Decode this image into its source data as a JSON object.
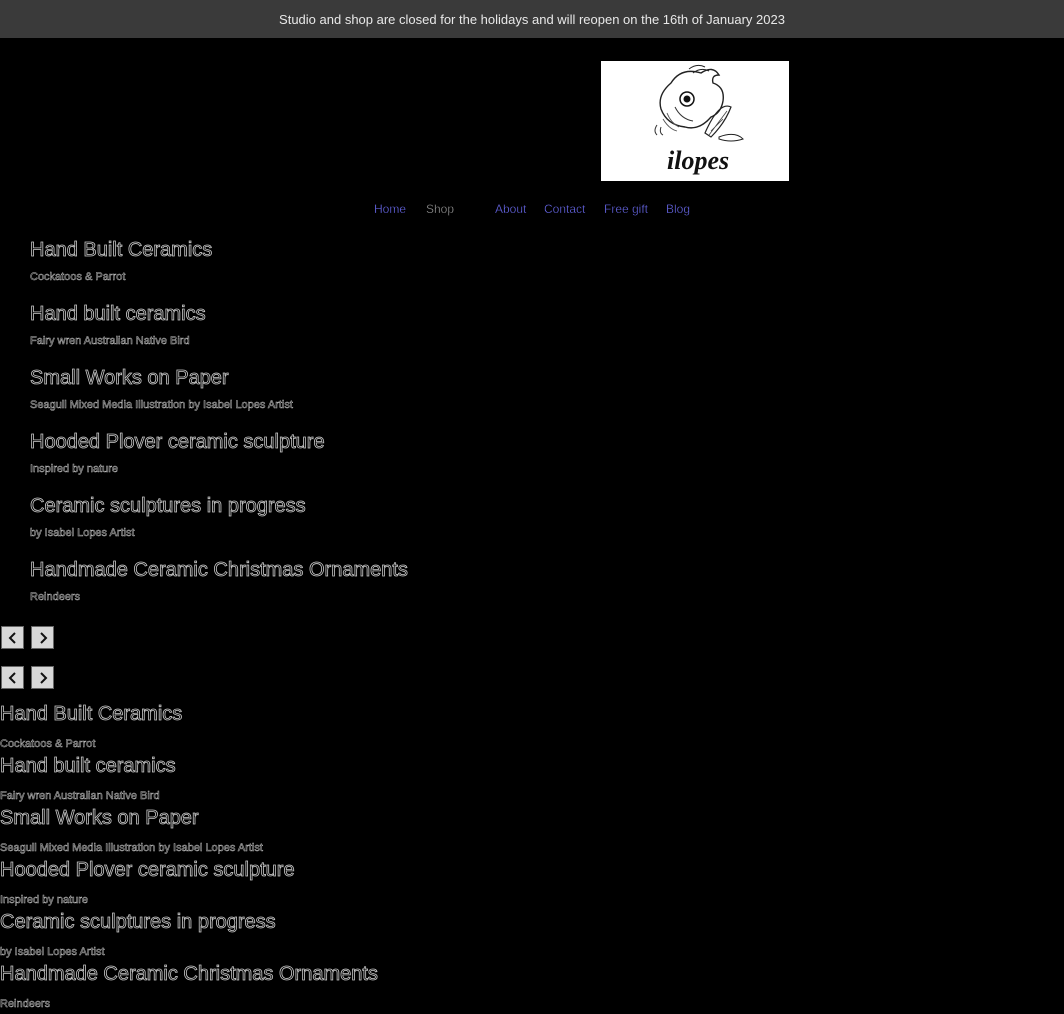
{
  "announcement": {
    "text": "Studio and shop are closed for the holidays and will reopen on the 16th of January 2023"
  },
  "logo": {
    "text": "ilopes"
  },
  "nav": {
    "items": [
      {
        "label": "Home"
      },
      {
        "label": "Shop"
      },
      {
        "label": "About"
      },
      {
        "label": "Contact"
      },
      {
        "label": "Free gift"
      },
      {
        "label": "Blog"
      }
    ]
  },
  "slides": [
    {
      "title": "Hand Built Ceramics",
      "subtitle": "Cockatoos & Parrot"
    },
    {
      "title": "Hand built ceramics",
      "subtitle": "Fairy wren Australian Native Bird"
    },
    {
      "title": "Small Works on Paper",
      "subtitle": "Seagull Mixed Media Illustration by Isabel Lopes Artist"
    },
    {
      "title": "Hooded Plover ceramic sculpture",
      "subtitle": "Inspired by nature"
    },
    {
      "title": "Ceramic sculptures in progress",
      "subtitle": "by Isabel Lopes Artist"
    },
    {
      "title": "Handmade Ceramic Christmas Ornaments",
      "subtitle": "Reindeers"
    }
  ],
  "carousel": {
    "prev_icon": "chevron-left-icon",
    "next_icon": "chevron-right-icon"
  },
  "colors": {
    "background": "#000000",
    "announcement_bar": "#3a3a3a",
    "nav_link": "#6b6bf0"
  }
}
